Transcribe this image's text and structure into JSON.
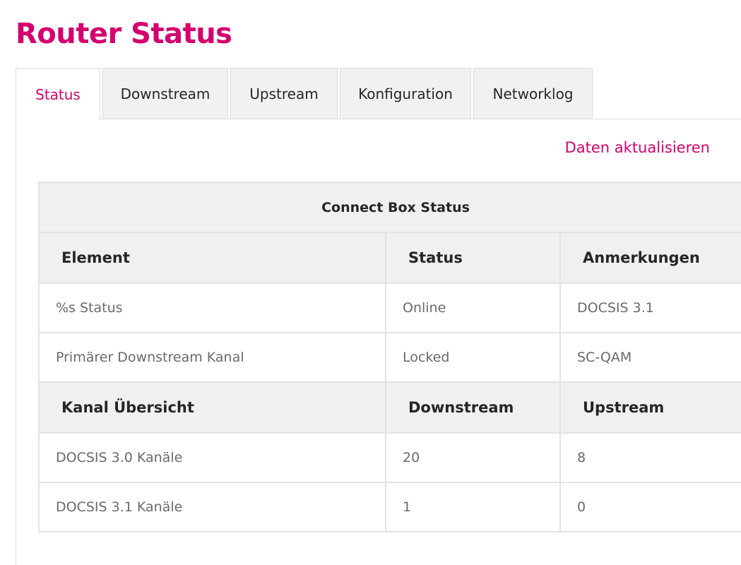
{
  "page": {
    "title": "Router Status"
  },
  "tabs": [
    {
      "label": "Status",
      "active": true
    },
    {
      "label": "Downstream",
      "active": false
    },
    {
      "label": "Upstream",
      "active": false
    },
    {
      "label": "Konfiguration",
      "active": false
    },
    {
      "label": "Networklog",
      "active": false
    }
  ],
  "actions": {
    "refresh_label": "Daten aktualisieren"
  },
  "status_table": {
    "caption": "Connect Box Status",
    "header1": [
      "Element",
      "Status",
      "Anmerkungen"
    ],
    "rows1": [
      [
        "%s Status",
        "Online",
        "DOCSIS 3.1"
      ],
      [
        "Primärer Downstream Kanal",
        "Locked",
        "SC-QAM"
      ]
    ],
    "header2": [
      "Kanal Übersicht",
      "Downstream",
      "Upstream"
    ],
    "rows2": [
      [
        "DOCSIS 3.0 Kanäle",
        "20",
        "8"
      ],
      [
        "DOCSIS 3.1 Kanäle",
        "1",
        "0"
      ]
    ]
  },
  "colors": {
    "accent": "#d4006f",
    "header_bg": "#f0f0f0",
    "tab_bg": "#f1f1f1",
    "border": "#e3e3e3"
  }
}
